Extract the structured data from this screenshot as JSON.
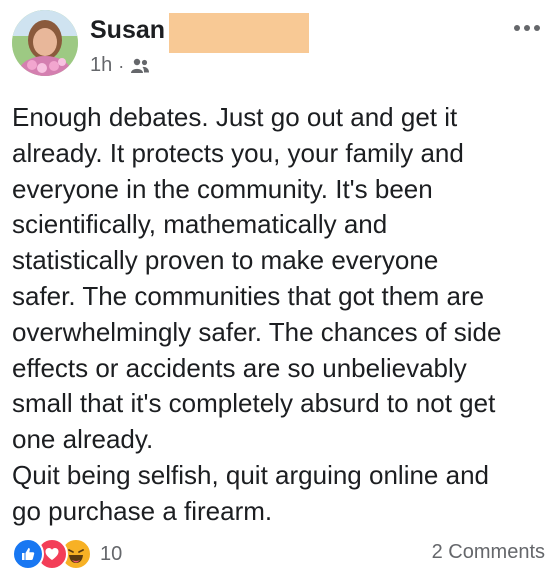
{
  "post": {
    "author": "Susan",
    "time": "1h",
    "separator": "·",
    "audience_icon": "friends-icon",
    "more_icon": "more-options-icon",
    "body": "Enough debates. Just go out and get it\nalready. It protects you, your family and\neveryone in the community. It's been\nscientifically, mathematically and\nstatistically proven to make everyone\nsafer. The communities that got them are\noverwhelmingly safer. The chances of side\neffects or accidents are so unbelievably\nsmall that it's completely absurd to not get\none already.\nQuit being selfish, quit arguing online and\ngo purchase a firearm."
  },
  "footer": {
    "reactions": [
      "like-icon",
      "love-icon",
      "haha-icon"
    ],
    "reaction_count": "10",
    "comments": "2 Comments"
  },
  "colors": {
    "text": "#1c1e21",
    "secondary_text": "#65676b",
    "redaction": "#f8c995",
    "like": "#1877f2",
    "love": "#f33e58",
    "haha": "#f7b125"
  }
}
